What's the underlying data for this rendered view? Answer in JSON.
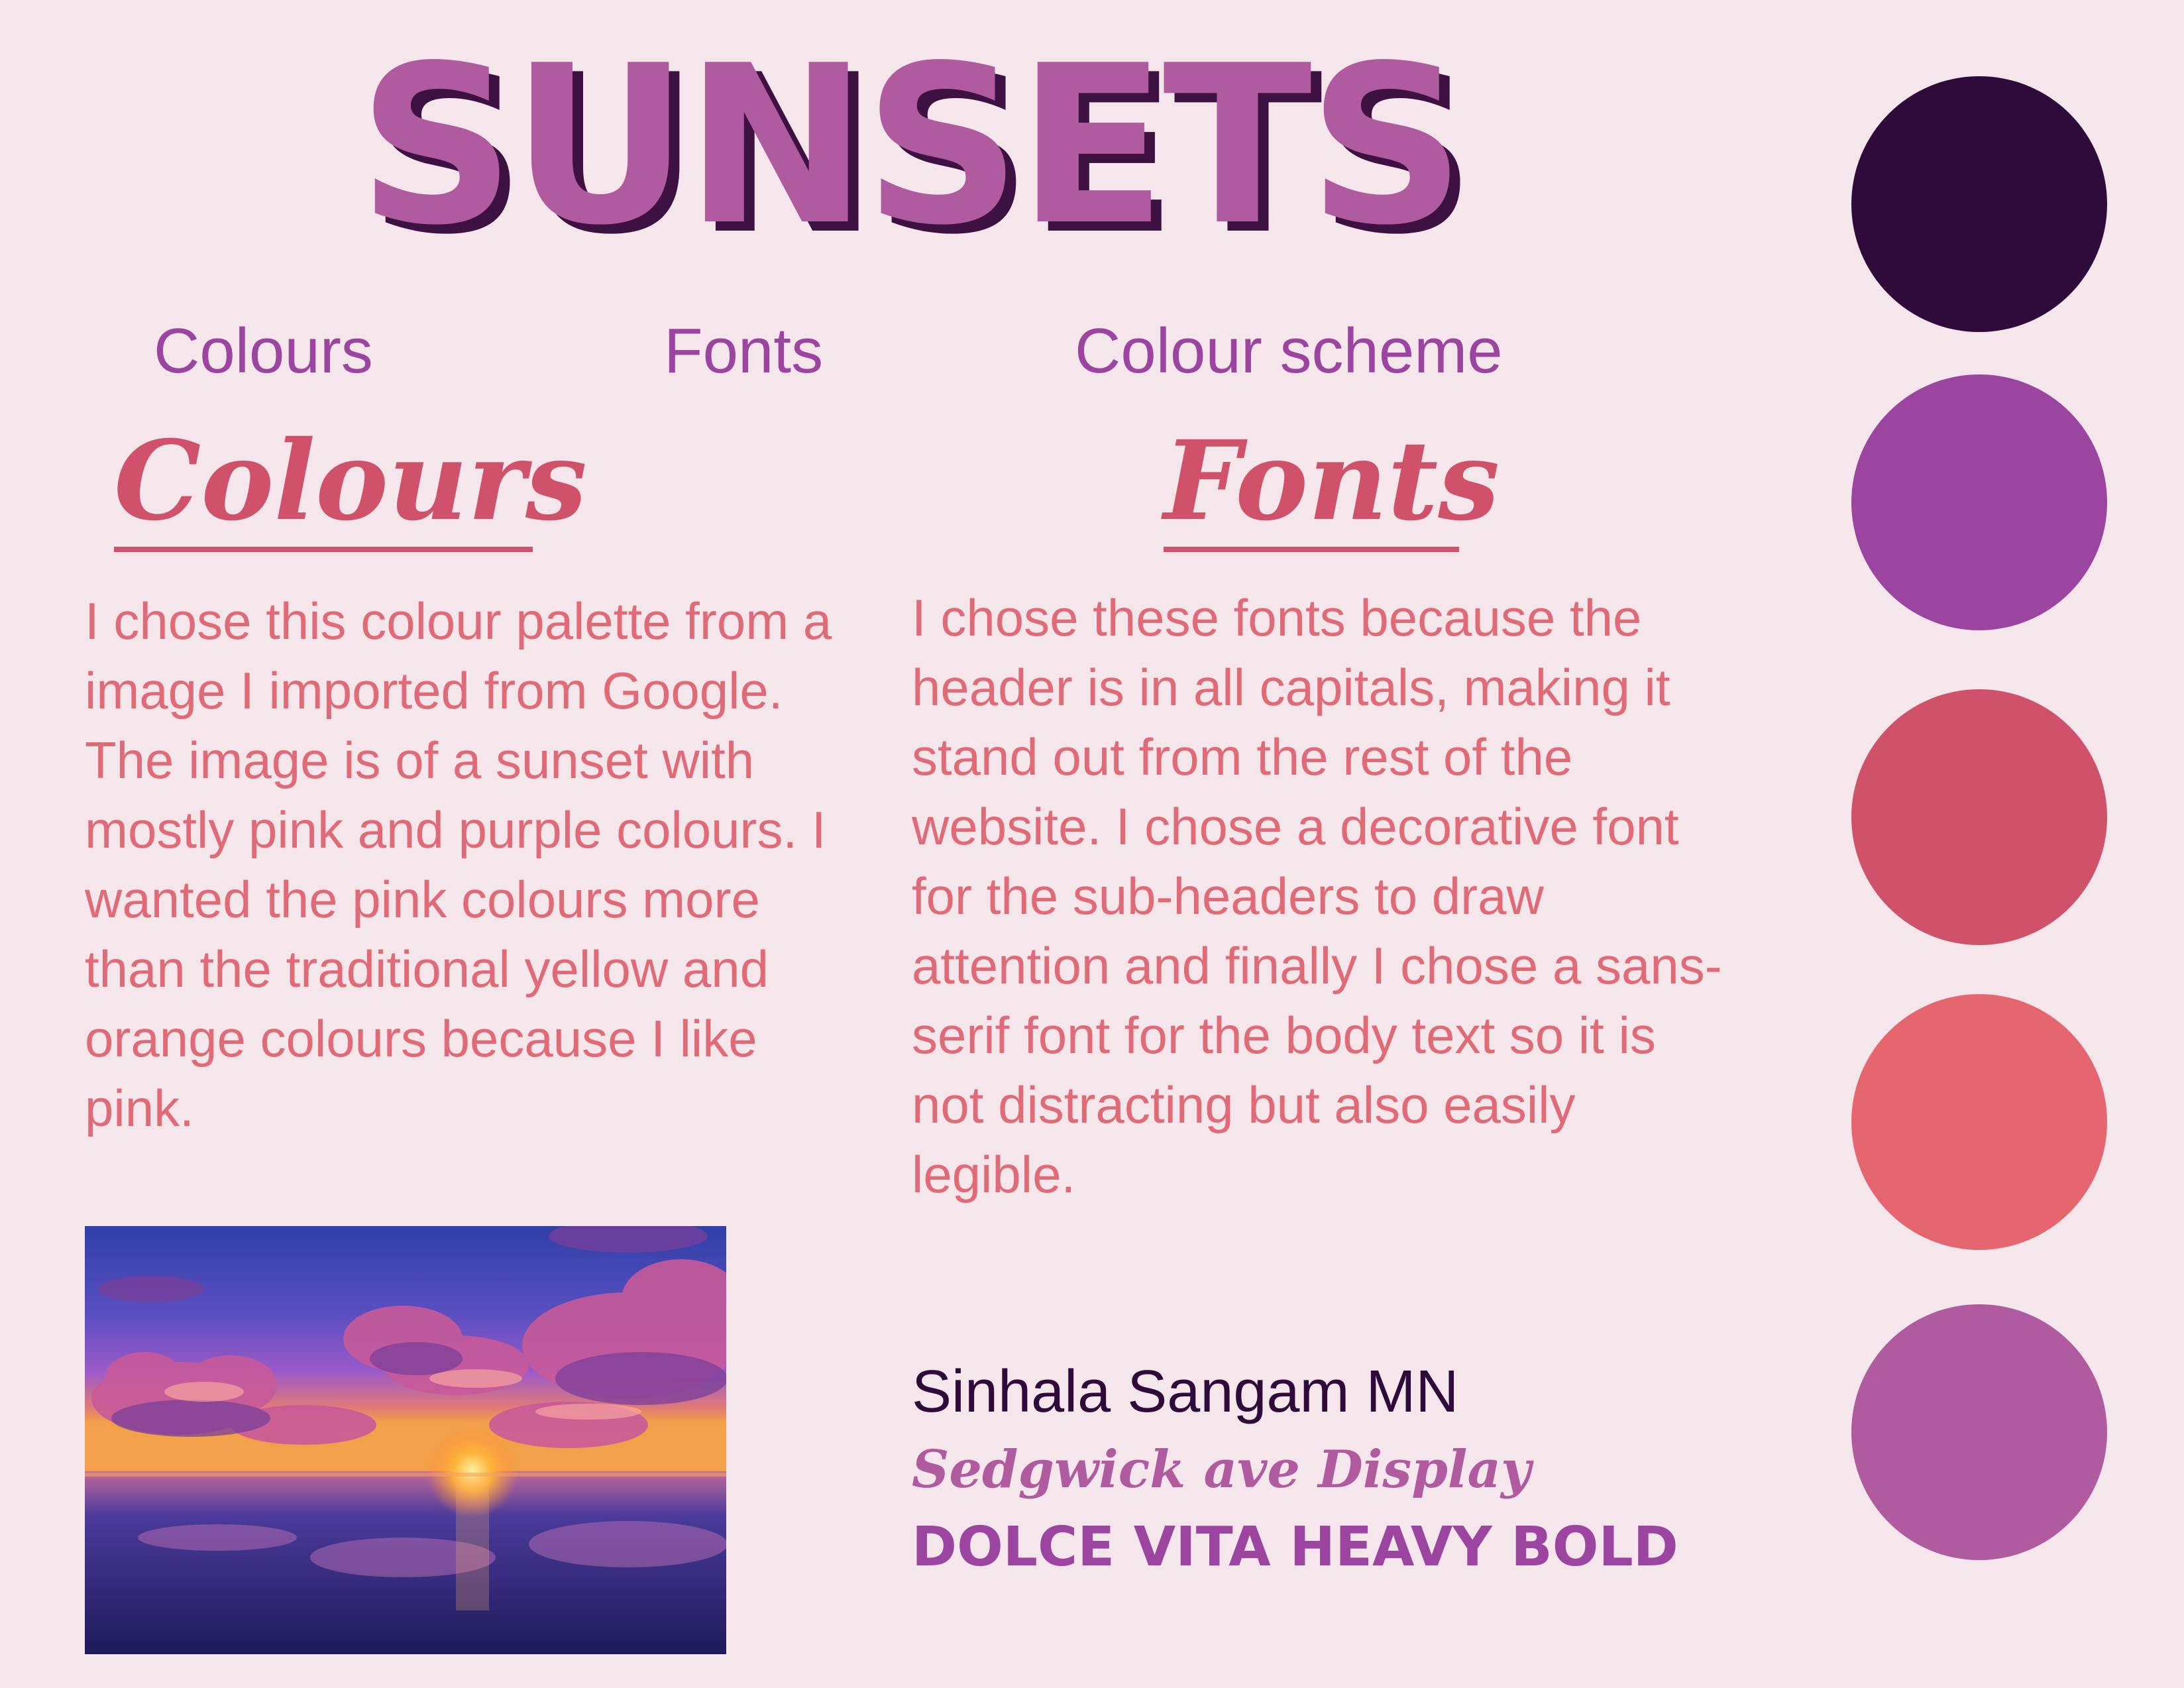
{
  "title": "SUNSETS",
  "nav": {
    "colours": "Colours",
    "fonts": "Fonts",
    "colour_scheme": "Colour scheme"
  },
  "colours_section": {
    "heading": "Colours",
    "body": "I chose this colour palette from a image I imported from Google. The image is of a sunset with mostly pink and purple colours. I wanted the pink colours more than the traditional yellow and orange colours because I like pink."
  },
  "fonts_section": {
    "heading": "Fonts",
    "body": "I chose these fonts because the header is in all capitals, making it stand out from the rest of the website. I chose a decorative font for the sub-headers to draw attention and finally I chose a sans-serif font for the body text so it is not distracting but also easily legible.",
    "samples": [
      "Sinhala Sangam MN",
      "Sedgwick ave Display",
      "DOLCE VITA HEAVY BOLD"
    ]
  },
  "swatches": [
    "#2e0b3a",
    "#9b45a0",
    "#cf526a",
    "#e5666f",
    "#b05aa0"
  ],
  "colors": {
    "background": "#f4e6ea",
    "title": "#b05aa0",
    "title_shadow": "#3d1242",
    "nav": "#9b45a0",
    "subheading": "#cf526a",
    "body": "#e06a75"
  }
}
